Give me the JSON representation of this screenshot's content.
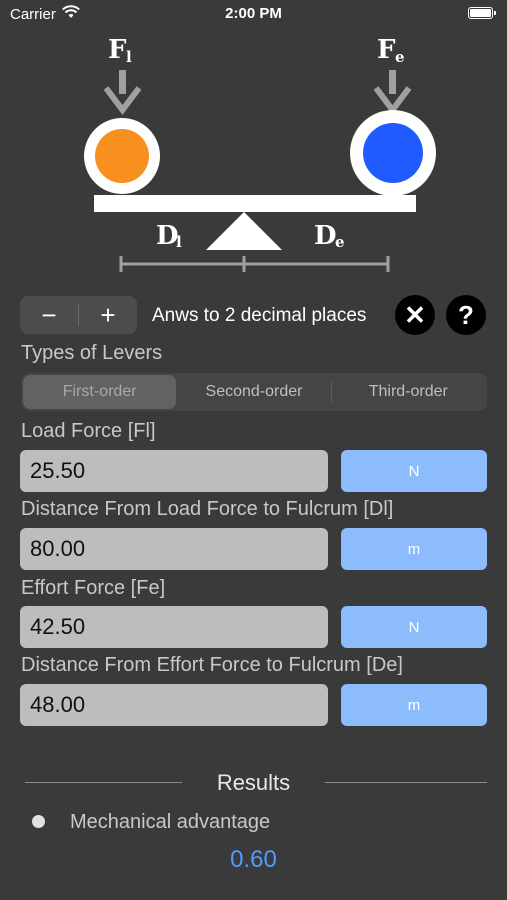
{
  "status_bar": {
    "carrier": "Carrier",
    "time": "2:00 PM"
  },
  "diagram": {
    "load_force_label": "F",
    "load_force_sub": "l",
    "effort_force_label": "F",
    "effort_force_sub": "e",
    "load_distance_label": "D",
    "load_distance_sub": "l",
    "effort_distance_label": "D",
    "effort_distance_sub": "e",
    "load_color": "#f7901e",
    "effort_color": "#1f5bff"
  },
  "toolbar": {
    "minus_label": "−",
    "plus_label": "+",
    "decimal_label": "Anws to 2 decimal places",
    "close_label": "✕",
    "help_label": "?"
  },
  "lever_types": {
    "title": "Types of Levers",
    "options": [
      "First-order",
      "Second-order",
      "Third-order"
    ],
    "selected": "First-order"
  },
  "inputs": [
    {
      "label": "Load Force [Fl]",
      "value": "25.50",
      "unit": "N"
    },
    {
      "label": "Distance From Load Force to Fulcrum [Dl]",
      "value": "80.00",
      "unit": "m"
    },
    {
      "label": "Effort Force [Fe]",
      "value": "42.50",
      "unit": "N"
    },
    {
      "label": "Distance From Effort Force to Fulcrum [De]",
      "value": "48.00",
      "unit": "m"
    }
  ],
  "results": {
    "title": "Results",
    "items": [
      {
        "label": "Mechanical advantage",
        "value": "0.60"
      }
    ]
  },
  "colors": {
    "accent": "#4d9bff",
    "unit_button": "#8cbcfc"
  }
}
